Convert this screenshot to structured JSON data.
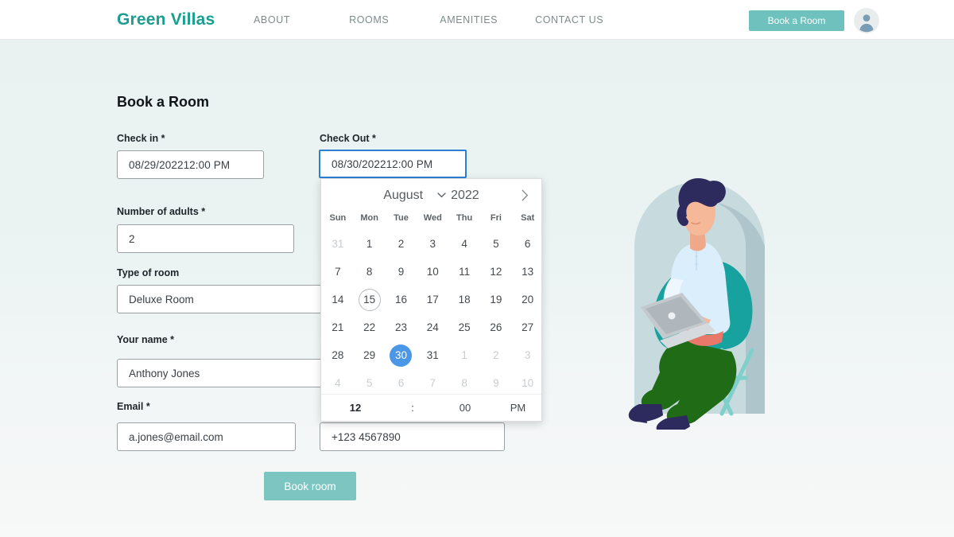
{
  "header": {
    "logo": "Green Villas",
    "nav": [
      {
        "label": "ABOUT"
      },
      {
        "label": "ROOMS"
      },
      {
        "label": "AMENITIES"
      },
      {
        "label": "CONTACT US"
      }
    ],
    "book_button": "Book a Room",
    "avatar_icon": "user-avatar-icon",
    "brand_color": "#1a9e8f",
    "button_color": "#6ec1bd"
  },
  "main": {
    "title": "Book a Room",
    "fields": {
      "checkin": {
        "label": "Check in *",
        "date": "08/29/2022",
        "time": "12:00 PM"
      },
      "checkout": {
        "label": "Check Out *",
        "date": "08/30/2022",
        "time": "12:00 PM",
        "focused": true
      },
      "adults": {
        "label": "Number of adults *",
        "value": "2"
      },
      "room_type": {
        "label": "Type of room",
        "value": "Deluxe Room"
      },
      "name": {
        "label": "Your name *",
        "value": "Anthony Jones"
      },
      "email": {
        "label": "Email *",
        "value": "a.jones@email.com"
      },
      "phone": {
        "label": "",
        "value": "+123 4567890"
      }
    },
    "submit_button": "Book room",
    "submit_color": "#7cc5c1"
  },
  "datepicker": {
    "month": "August",
    "year": "2022",
    "month_dropdown_icon": "chevron-down-icon",
    "next_icon": "chevron-right-icon",
    "weekdays": [
      "Sun",
      "Mon",
      "Tue",
      "Wed",
      "Thu",
      "Fri",
      "Sat"
    ],
    "selected_day": "30",
    "today": "15",
    "selected_color": "#4a97e8",
    "weeks": [
      [
        {
          "d": "31",
          "muted": true
        },
        {
          "d": "1"
        },
        {
          "d": "2"
        },
        {
          "d": "3"
        },
        {
          "d": "4"
        },
        {
          "d": "5"
        },
        {
          "d": "6"
        }
      ],
      [
        {
          "d": "7"
        },
        {
          "d": "8"
        },
        {
          "d": "9"
        },
        {
          "d": "10"
        },
        {
          "d": "11"
        },
        {
          "d": "12"
        },
        {
          "d": "13"
        }
      ],
      [
        {
          "d": "14"
        },
        {
          "d": "15",
          "today": true
        },
        {
          "d": "16"
        },
        {
          "d": "17"
        },
        {
          "d": "18"
        },
        {
          "d": "19"
        },
        {
          "d": "20"
        }
      ],
      [
        {
          "d": "21"
        },
        {
          "d": "22"
        },
        {
          "d": "23"
        },
        {
          "d": "24"
        },
        {
          "d": "25"
        },
        {
          "d": "26"
        },
        {
          "d": "27"
        }
      ],
      [
        {
          "d": "28"
        },
        {
          "d": "29"
        },
        {
          "d": "30",
          "selected": true
        },
        {
          "d": "31"
        },
        {
          "d": "1",
          "muted": true
        },
        {
          "d": "2",
          "muted": true
        },
        {
          "d": "3",
          "muted": true
        }
      ],
      [
        {
          "d": "4",
          "muted": true
        },
        {
          "d": "5",
          "muted": true
        },
        {
          "d": "6",
          "muted": true
        },
        {
          "d": "7",
          "muted": true
        },
        {
          "d": "8",
          "muted": true
        },
        {
          "d": "9",
          "muted": true
        },
        {
          "d": "10",
          "muted": true
        }
      ]
    ],
    "time": {
      "hour": "12",
      "colon": ":",
      "minute": "00",
      "meridiem": "PM"
    }
  },
  "illustration": {
    "name": "woman-sitting-in-chair-with-laptop-illustration",
    "colors": {
      "arch": "#c7dadd",
      "arch_shadow": "#aec6cb",
      "chair": "#17a2a0",
      "chair_legs": "#7fcfcb",
      "shirt": "#dbeefb",
      "pants": "#1f6b16",
      "hair": "#2d2a5e",
      "skin": "#f5b99a",
      "shoes": "#2d2a5e",
      "laptop": "#b9bfc3"
    }
  }
}
